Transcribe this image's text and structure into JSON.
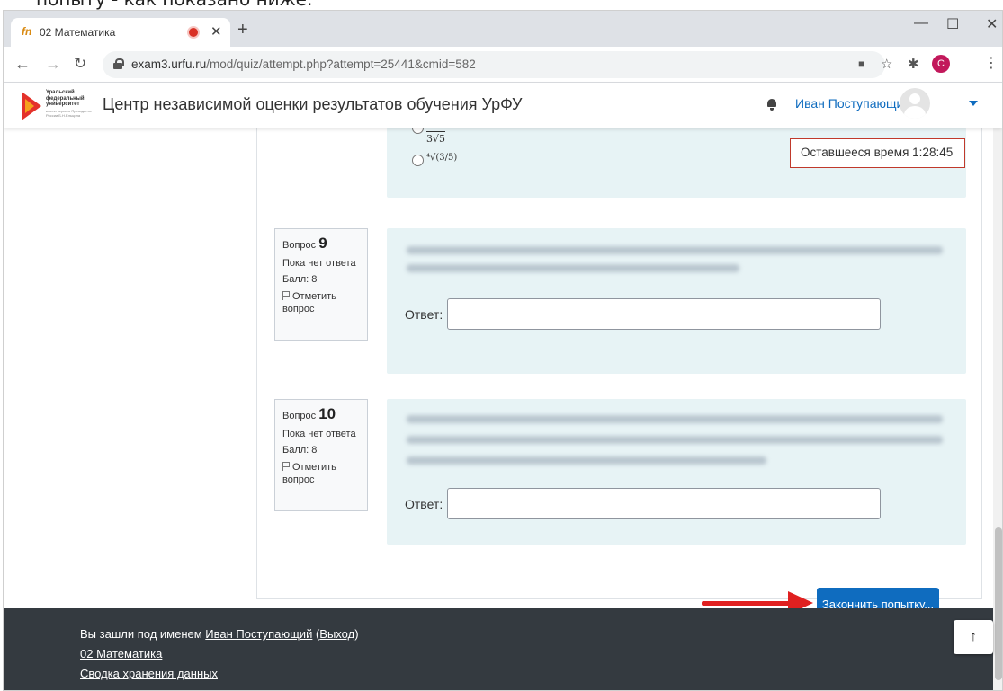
{
  "caption": "попыту - как показано ниже.",
  "browser": {
    "tab_favicon": "fn",
    "tab_title": "02 Математика",
    "tab_close": "✕",
    "new_tab": "+",
    "url_host": "exam3.urfu.ru",
    "url_path": "/mod/quiz/attempt.php?attempt=25441&cmid=582",
    "profile_initial": "C",
    "window_minimize": "—",
    "window_maximize": "☐",
    "window_close": "✕"
  },
  "site": {
    "logo_text": "Уральский федеральный университет",
    "logo_subtext": "имени первого Президента России Б.Н.Ельцина",
    "title": "Центр независимой оценки результатов обучения УрФУ",
    "user_name": "Иван Поступающий"
  },
  "timer": {
    "label": "Оставшееся время",
    "value": "1:28:45"
  },
  "previous_question": {
    "options": [
      "3√5",
      "⁴√(3/5)"
    ]
  },
  "questions": [
    {
      "label": "Вопрос",
      "number": "9",
      "status": "Пока нет ответа",
      "score": "Балл: 8",
      "flag": "Отметить вопрос",
      "answer_label": "Ответ:",
      "answer_value": ""
    },
    {
      "label": "Вопрос",
      "number": "10",
      "status": "Пока нет ответа",
      "score": "Балл: 8",
      "flag": "Отметить вопрос",
      "answer_label": "Ответ:",
      "answer_value": ""
    }
  ],
  "finish_button": "Закончить попытку...",
  "footer": {
    "logged_in_prefix": "Вы зашли под именем",
    "user_link": "Иван Поступающий",
    "logout_link": "Выход",
    "course_link": "02 Математика",
    "policy_link": "Сводка хранения данных"
  },
  "colors": {
    "accent": "#0f6cbf",
    "question_bg": "#e7f3f5",
    "footer_bg": "#343a40",
    "timer_border": "#c0392b",
    "arrow": "#e02020"
  }
}
